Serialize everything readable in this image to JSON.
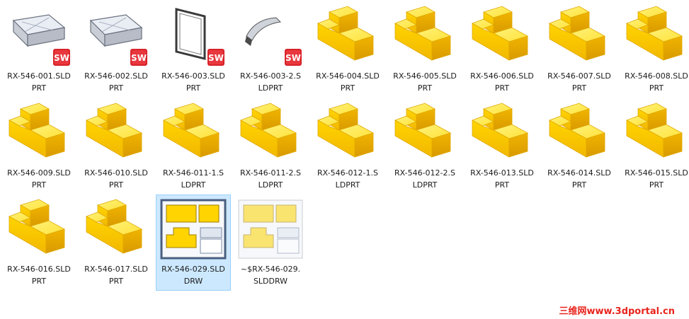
{
  "files": [
    {
      "name": "RX-546-001.SLD\nPRT",
      "icon": "sheetmetal-part-thumbnail",
      "badge": true,
      "selected": false
    },
    {
      "name": "RX-546-002.SLD\nPRT",
      "icon": "sheetmetal-part-thumbnail",
      "badge": true,
      "selected": false
    },
    {
      "name": "RX-546-003.SLD\nPRT",
      "icon": "frame-part-thumbnail",
      "badge": true,
      "selected": false
    },
    {
      "name": "RX-546-003-2.S\nLDPRT",
      "icon": "curved-part-thumbnail",
      "badge": true,
      "selected": false
    },
    {
      "name": "RX-546-004.SLD\nPRT",
      "icon": "solidworks-part-icon",
      "badge": false,
      "selected": false
    },
    {
      "name": "RX-546-005.SLD\nPRT",
      "icon": "solidworks-part-icon",
      "badge": false,
      "selected": false
    },
    {
      "name": "RX-546-006.SLD\nPRT",
      "icon": "solidworks-part-icon",
      "badge": false,
      "selected": false
    },
    {
      "name": "RX-546-007.SLD\nPRT",
      "icon": "solidworks-part-icon",
      "badge": false,
      "selected": false
    },
    {
      "name": "RX-546-008.SLD\nPRT",
      "icon": "solidworks-part-icon",
      "badge": false,
      "selected": false
    },
    {
      "name": "RX-546-009.SLD\nPRT",
      "icon": "solidworks-part-icon",
      "badge": false,
      "selected": false
    },
    {
      "name": "RX-546-010.SLD\nPRT",
      "icon": "solidworks-part-icon",
      "badge": false,
      "selected": false
    },
    {
      "name": "RX-546-011-1.S\nLDPRT",
      "icon": "solidworks-part-icon",
      "badge": false,
      "selected": false
    },
    {
      "name": "RX-546-011-2.S\nLDPRT",
      "icon": "solidworks-part-icon",
      "badge": false,
      "selected": false
    },
    {
      "name": "RX-546-012-1.S\nLDPRT",
      "icon": "solidworks-part-icon",
      "badge": false,
      "selected": false
    },
    {
      "name": "RX-546-012-2.S\nLDPRT",
      "icon": "solidworks-part-icon",
      "badge": false,
      "selected": false
    },
    {
      "name": "RX-546-013.SLD\nPRT",
      "icon": "solidworks-part-icon",
      "badge": false,
      "selected": false
    },
    {
      "name": "RX-546-014.SLD\nPRT",
      "icon": "solidworks-part-icon",
      "badge": false,
      "selected": false
    },
    {
      "name": "RX-546-015.SLD\nPRT",
      "icon": "solidworks-part-icon",
      "badge": false,
      "selected": false
    },
    {
      "name": "RX-546-016.SLD\nPRT",
      "icon": "solidworks-part-icon",
      "badge": false,
      "selected": false
    },
    {
      "name": "RX-546-017.SLD\nPRT",
      "icon": "solidworks-part-icon",
      "badge": false,
      "selected": false
    },
    {
      "name": "RX-546-029.SLD\nDRW",
      "icon": "solidworks-drawing-icon",
      "badge": false,
      "selected": true
    },
    {
      "name": "~$RX-546-029.\nSLDDRW",
      "icon": "solidworks-drawing-temp-icon",
      "badge": false,
      "selected": false
    }
  ],
  "watermark": "三维网www.3dportal.cn",
  "colors": {
    "selection_bg": "#cce8ff",
    "selection_border": "#99d1ff",
    "part_yellow": "#ffd400",
    "badge_red": "#d8232a",
    "watermark_red": "#e8241c"
  }
}
